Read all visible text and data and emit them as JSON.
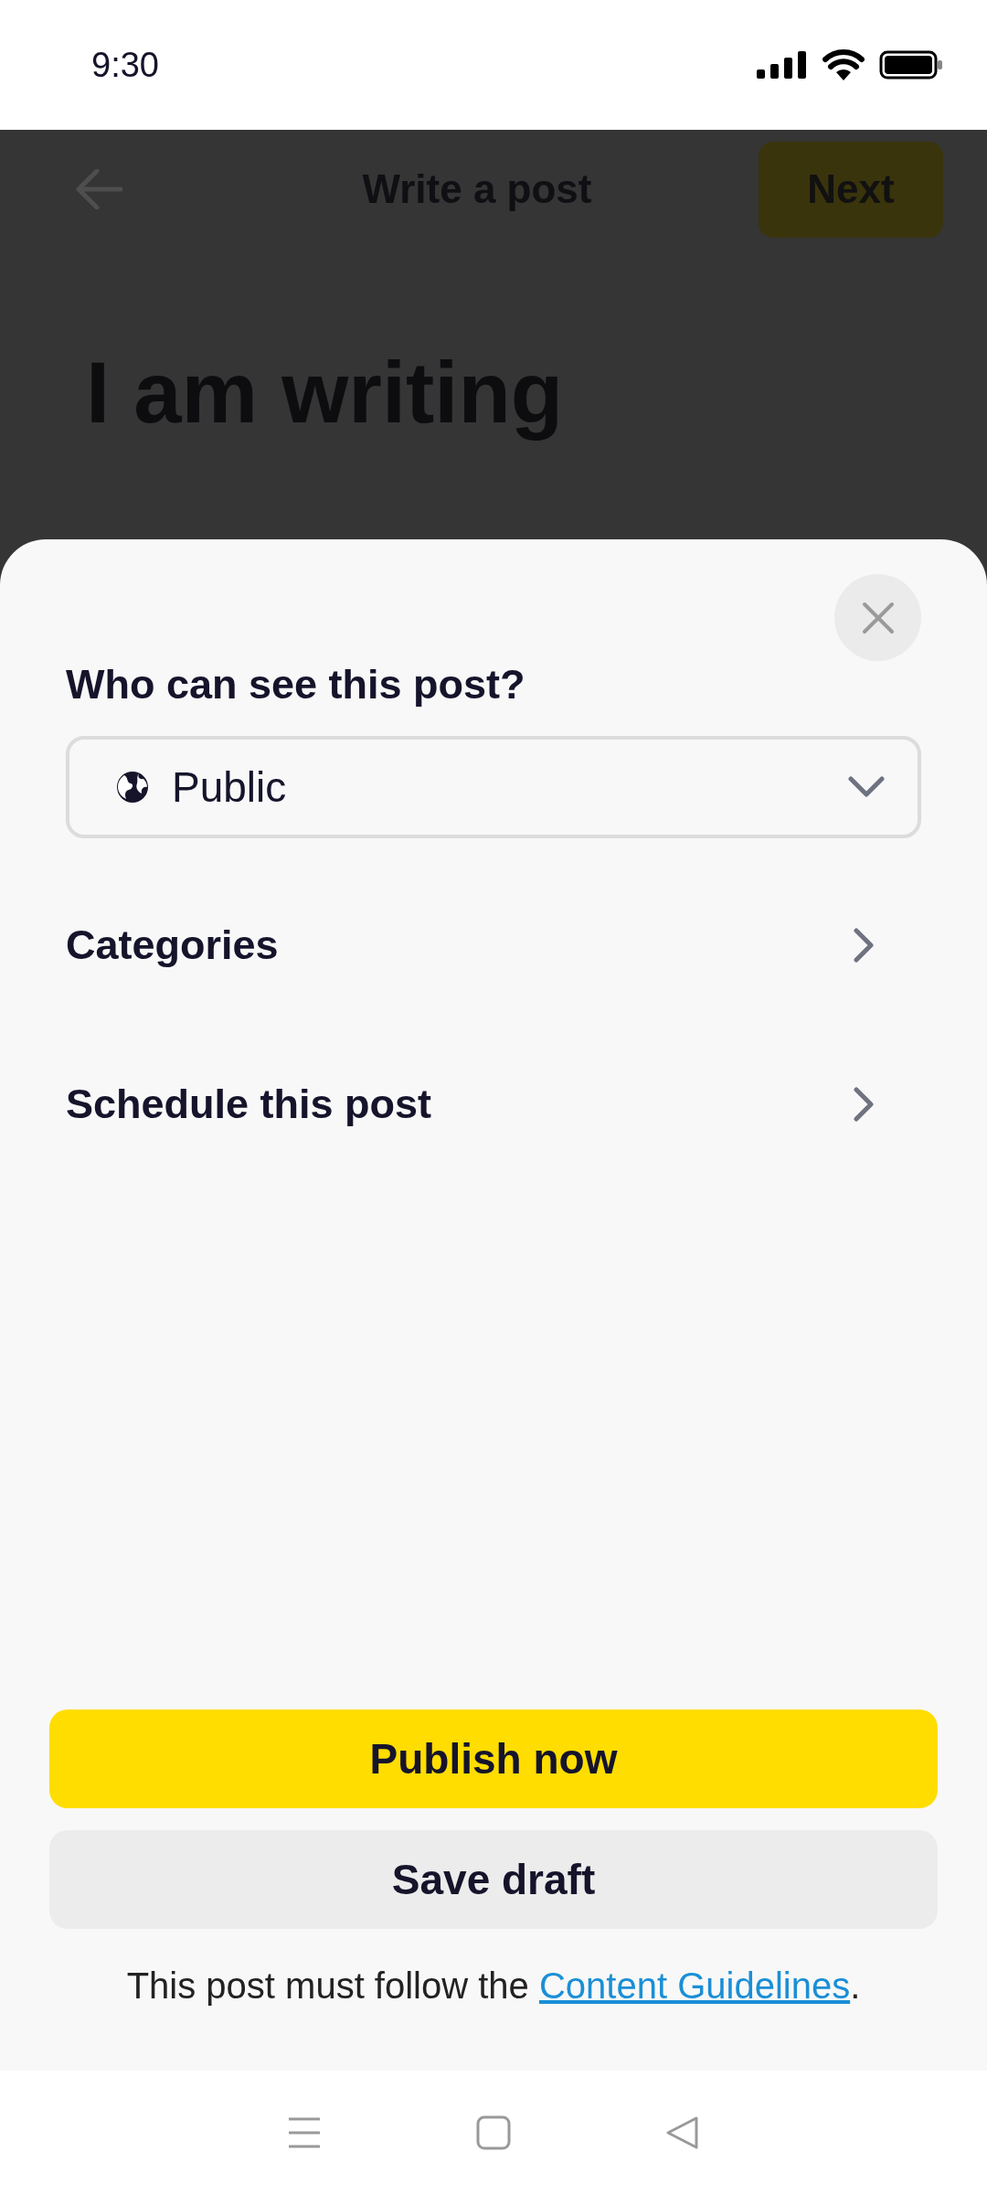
{
  "status_bar": {
    "time": "9:30"
  },
  "header": {
    "title": "Write a post",
    "next_button": "Next"
  },
  "post": {
    "title": "I am writing"
  },
  "sheet": {
    "question": "Who can see this post?",
    "visibility": {
      "value": "Public"
    },
    "options": [
      {
        "label": "Categories"
      },
      {
        "label": "Schedule this post"
      }
    ],
    "buttons": [
      {
        "label": "Publish now",
        "kind": "primary"
      },
      {
        "label": "Save draft",
        "kind": "secondary"
      }
    ],
    "footer": {
      "text": "This post must follow the ",
      "link": "Content Guidelines",
      "end": "."
    }
  }
}
